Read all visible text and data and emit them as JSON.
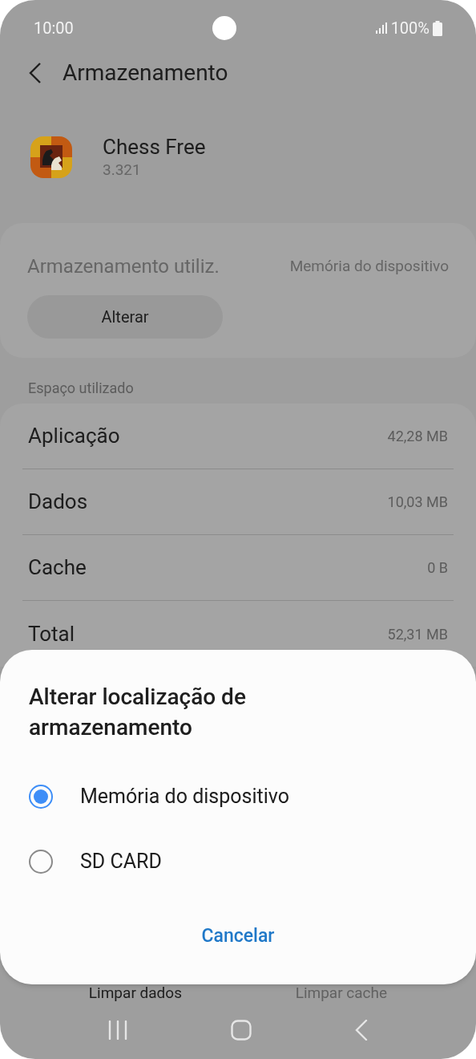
{
  "status_bar": {
    "time": "10:00",
    "battery": "100%"
  },
  "header": {
    "title": "Armazenamento"
  },
  "app": {
    "name": "Chess Free",
    "version": "3.321"
  },
  "storage_card": {
    "label": "Armazenamento utiliz.",
    "value": "Memória do dispositivo",
    "button": "Alterar"
  },
  "section_header": "Espaço utilizado",
  "usage_rows": [
    {
      "label": "Aplicação",
      "value": "42,28 MB"
    },
    {
      "label": "Dados",
      "value": "10,03 MB"
    },
    {
      "label": "Cache",
      "value": "0 B"
    },
    {
      "label": "Total",
      "value": "52,31 MB"
    }
  ],
  "bottom_buttons": [
    {
      "label": "Limpar dados",
      "disabled": false
    },
    {
      "label": "Limpar cache",
      "disabled": true
    }
  ],
  "dialog": {
    "title": "Alterar localização de armazenamento",
    "options": [
      {
        "label": "Memória do dispositivo",
        "selected": true
      },
      {
        "label": "SD CARD",
        "selected": false
      }
    ],
    "cancel": "Cancelar"
  }
}
